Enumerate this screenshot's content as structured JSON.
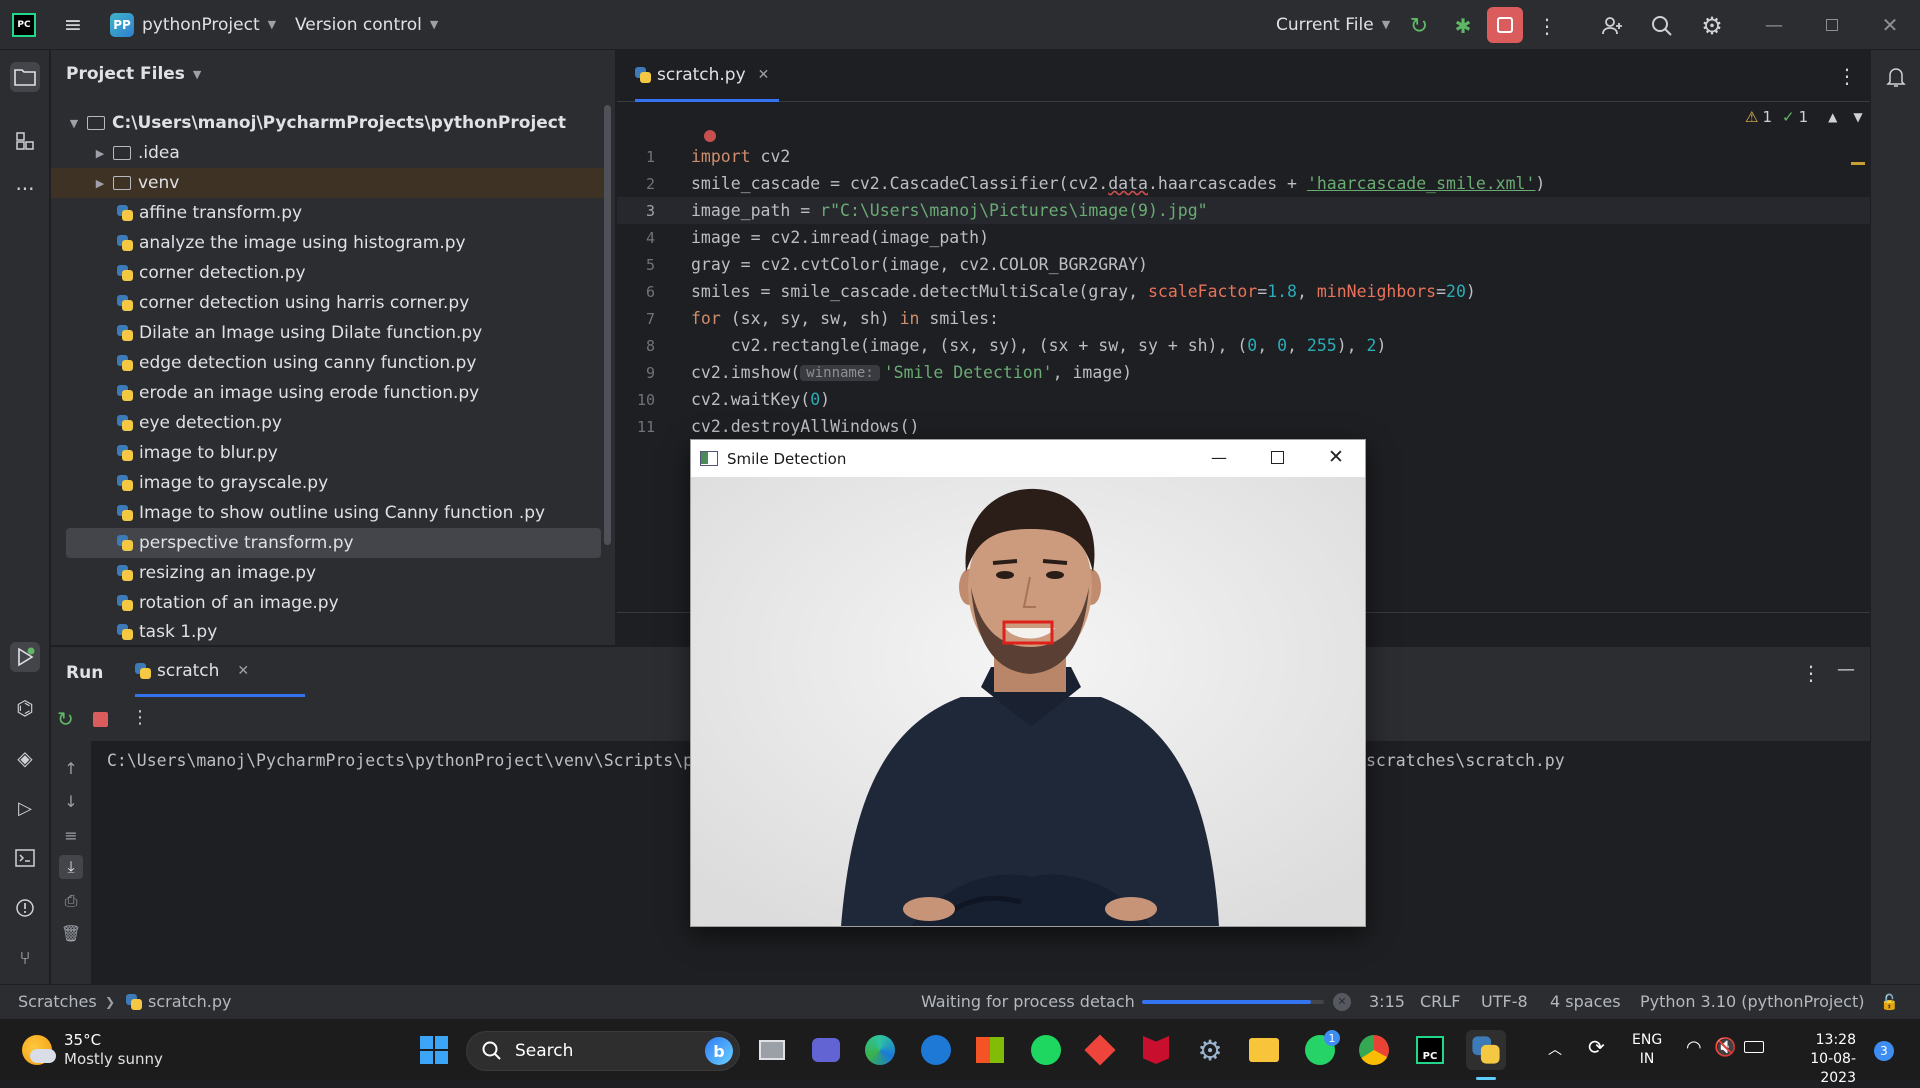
{
  "titlebar": {
    "project_badge": "PP",
    "project_name": "pythonProject",
    "version_control": "Version control",
    "run_config": "Current File"
  },
  "project_panel": {
    "title": "Project Files",
    "root": "C:\\Users\\manoj\\PycharmProjects\\pythonProject",
    "folders": [
      ".idea",
      "venv"
    ],
    "files": [
      "affine transform.py",
      "analyze the image using histogram.py",
      "corner detection.py",
      "corner detection using harris corner.py",
      "Dilate an Image using Dilate function.py",
      "edge detection using canny function.py",
      "erode an image using erode function.py",
      "eye detection.py",
      "image to blur.py",
      "image to grayscale.py",
      "Image to show outline using Canny function .py",
      "perspective transform.py",
      "resizing an image.py",
      "rotation of an image.py",
      "task 1.py"
    ],
    "selected_file": "perspective transform.py"
  },
  "editor": {
    "tab": "scratch.py",
    "inspections": {
      "warnings": "1",
      "typos": "1"
    },
    "line_numbers": [
      "1",
      "2",
      "3",
      "4",
      "5",
      "6",
      "7",
      "8",
      "9",
      "10",
      "11"
    ],
    "lines": {
      "l1_kw": "import",
      "l1_rest": " cv2",
      "l2_a": "smile_cascade = cv2.CascadeClassifier(cv2.",
      "l2_b": "data",
      "l2_c": ".haarcascades + ",
      "l2_str": "'haarcascade_smile.xml'",
      "l2_d": ")",
      "l3_a": "image_path = ",
      "l3_str": "r\"C:\\Users\\manoj\\Pictures\\image(9).jpg\"",
      "l4": "image = cv2.imread(image_path)",
      "l5": "gray = cv2.cvtColor(image, cv2.COLOR_BGR2GRAY)",
      "l6_a": "smiles = smile_cascade.detectMultiScale(gray, ",
      "l6_p1": "scaleFactor",
      "l6_eq1": "=",
      "l6_n1": "1.8",
      "l6_sep": ", ",
      "l6_p2": "minNeighbors",
      "l6_eq2": "=",
      "l6_n2": "20",
      "l6_end": ")",
      "l7_kw1": "for",
      "l7_mid": " (sx, sy, sw, sh) ",
      "l7_kw2": "in",
      "l7_end": " smiles:",
      "l8_a": "    cv2.rectangle(image, (sx, sy), (sx + sw, sy + sh), (",
      "l8_n1": "0",
      "l8_c1": ", ",
      "l8_n2": "0",
      "l8_c2": ", ",
      "l8_n3": "255",
      "l8_c3": "), ",
      "l8_n4": "2",
      "l8_end": ")",
      "l9_a": "cv2.imshow(",
      "l9_hint": "winname:",
      "l9_str": "'Smile Detection'",
      "l9_end": ", image)",
      "l10_a": "cv2.waitKey(",
      "l10_n": "0",
      "l10_end": ")",
      "l11": "cv2.destroyAllWindows()"
    }
  },
  "run_panel": {
    "tab_run": "Run",
    "tab_scratch": "scratch",
    "console_left": "C:\\Users\\manoj\\PycharmProjects\\pythonProject\\venv\\Scripts\\p",
    "console_right": "scratches\\scratch.py"
  },
  "cv_window": {
    "title": "Smile Detection",
    "detection_color": "#e0201a"
  },
  "statusbar": {
    "crumb1": "Scratches",
    "crumb2": "scratch.py",
    "process": "Waiting for process detach",
    "progress": 0.93,
    "position": "3:15",
    "line_sep": "CRLF",
    "encoding": "UTF-8",
    "indent": "4 spaces",
    "interpreter": "Python 3.10 (pythonProject)"
  },
  "taskbar": {
    "weather_temp": "35°C",
    "weather_desc": "Mostly sunny",
    "search": "Search",
    "lang1": "ENG",
    "lang2": "IN",
    "time": "13:28",
    "date": "10-08-2023",
    "whatsapp_badge": "1",
    "notif_count": "3"
  },
  "colors": {
    "accent": "#3574f0",
    "stop_button": "#db5c5c",
    "run_green": "#5fb865"
  }
}
